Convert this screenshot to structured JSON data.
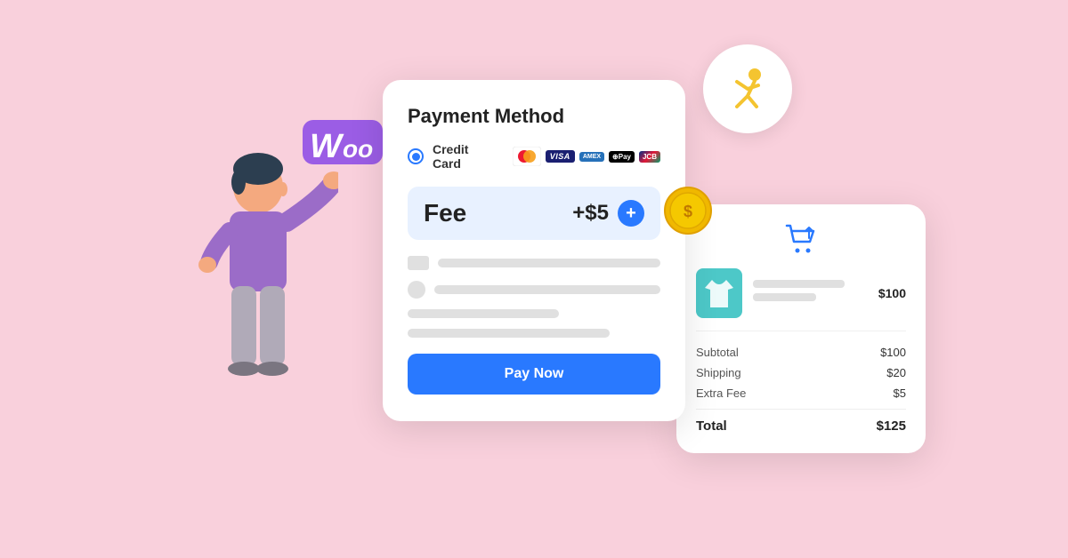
{
  "scene": {
    "background_color": "#f9d0dc"
  },
  "woo_logo": {
    "text": "Woo",
    "color": "#9b5de5"
  },
  "payment_card": {
    "title": "Payment Method",
    "selected_method": "Credit Card",
    "card_brands": [
      "Mastercard",
      "Visa",
      "Amex",
      "Apple Pay",
      "JCB"
    ],
    "fee": {
      "label": "Fee",
      "amount": "+$5",
      "plus_button": "+"
    },
    "pay_button_label": "Pay Now"
  },
  "order_card": {
    "product_price": "$100",
    "rows": [
      {
        "label": "Subtotal",
        "value": "$100"
      },
      {
        "label": "Shipping",
        "value": "$20"
      },
      {
        "label": "Extra Fee",
        "value": "$5"
      }
    ],
    "total_label": "Total",
    "total_value": "$125"
  },
  "icons": {
    "cart": "🛒",
    "coin": "$",
    "runner": "🏃",
    "shirt_color": "#4dc8c8"
  }
}
